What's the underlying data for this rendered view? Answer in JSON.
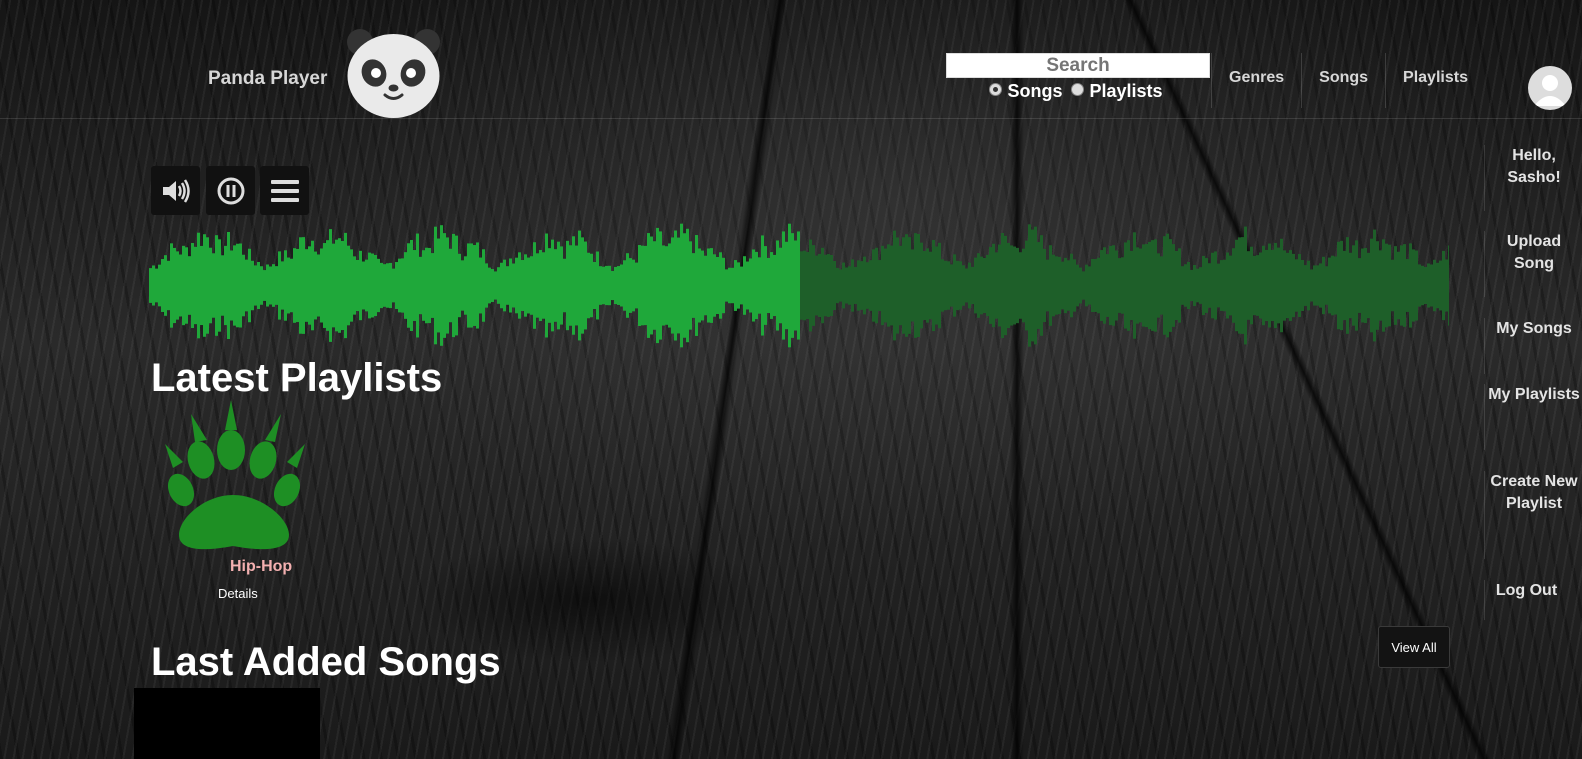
{
  "header": {
    "brand": "Panda Player",
    "search": {
      "placeholder": "Search",
      "options": [
        "Songs",
        "Playlists"
      ],
      "selected": "Songs"
    },
    "nav": [
      "Genres",
      "Songs",
      "Playlists"
    ]
  },
  "sidebar": {
    "items": [
      "Hello, Sasho!",
      "Upload Song",
      "My Songs",
      "My Playlists",
      "Create New Playlist",
      "Log Out"
    ]
  },
  "player": {
    "controls": [
      "volume-icon",
      "pause-icon",
      "menu-icon"
    ],
    "progress": 0.5,
    "colors": {
      "played": "#1fa83a",
      "remaining": "#1e5f29"
    }
  },
  "latest_playlists": {
    "title": "Latest Playlists",
    "items": [
      {
        "name": "Hip-Hop",
        "details_label": "Details",
        "icon": "paw-icon"
      }
    ]
  },
  "last_added_songs": {
    "title": "Last Added Songs",
    "view_all_label": "View All"
  }
}
